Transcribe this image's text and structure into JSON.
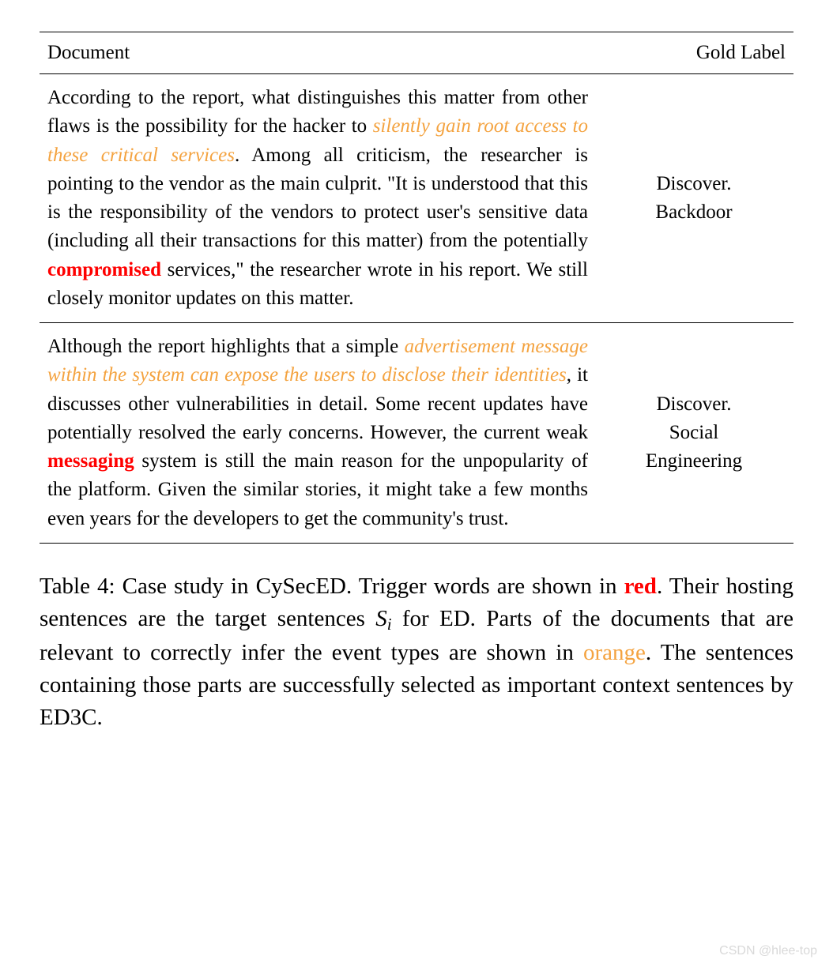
{
  "table": {
    "headers": {
      "document": "Document",
      "gold_label": "Gold Label"
    },
    "rows": [
      {
        "doc": {
          "p1a": "According to the report, what distinguishes this matter from other flaws is the possibility for the hacker to ",
          "p1_orange": "silently gain root access to these critical services",
          "p1b": ". Among all criticism, the researcher is pointing to the vendor as the main culprit. \"It is understood that this is the responsibility of the vendors to protect user's sensitive data (including all their transactions for this matter) from the potentially ",
          "p1_red": "compromised",
          "p1c": " services,\" the researcher wrote in his report. We still closely monitor updates on this matter."
        },
        "label_line1": "Discover.",
        "label_line2": "Backdoor"
      },
      {
        "doc": {
          "p1a": "Although the report highlights that a simple ",
          "p1_orange": "advertisement message within the system can expose the users to disclose their identities",
          "p1b": ", it discusses other vulnerabilities in detail. Some recent updates have potentially resolved the early concerns. However, the current weak ",
          "p1_red": "messaging",
          "p1c": " system is still the main reason for the unpopularity of the platform. Given the similar stories, it might take a few months even years for the developers to get the community's trust."
        },
        "label_line1": "Discover.",
        "label_line2": "Social",
        "label_line3": "Engineering"
      }
    ]
  },
  "caption": {
    "c1": "Table 4:  Case study in CySecED. Trigger words are shown in ",
    "c_red": "red",
    "c2": ".  Their hosting sentences are the target sentences ",
    "c_math_S": "S",
    "c_math_i": "i",
    "c3": " for ED. Parts of the documents that are relevant to correctly infer the event types are shown in ",
    "c_orange": "orange",
    "c4": ". The sentences containing those parts are successfully selected as important context sentences by ED3C."
  },
  "watermark": "CSDN @hlee-top"
}
